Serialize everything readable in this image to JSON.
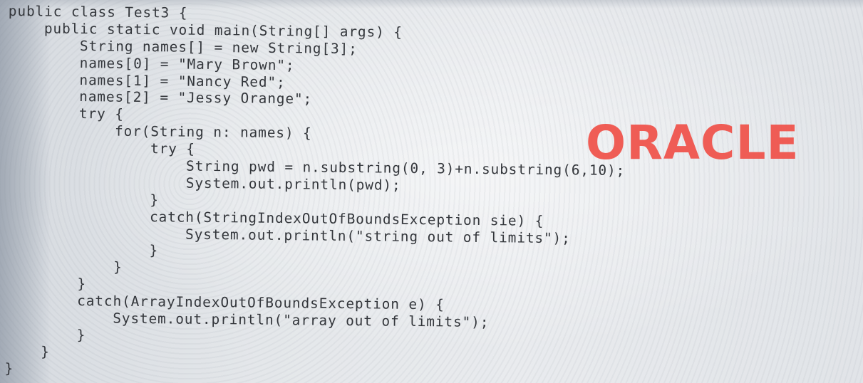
{
  "code": {
    "lines": [
      "public class Test3 {",
      "    public static void main(String[] args) {",
      "        String names[] = new String[3];",
      "        names[0] = \"Mary Brown\";",
      "        names[1] = \"Nancy Red\";",
      "        names[2] = \"Jessy Orange\";",
      "        try {",
      "            for(String n: names) {",
      "                try {",
      "                    String pwd = n.substring(0, 3)+n.substring(6,10);",
      "                    System.out.println(pwd);",
      "                }",
      "                catch(StringIndexOutOfBoundsException sie) {",
      "                    System.out.println(\"string out of limits\");",
      "                }",
      "            }",
      "        }",
      "        catch(ArrayIndexOutOfBoundsException e) {",
      "            System.out.println(\"array out of limits\");",
      "        }",
      "    }",
      "}"
    ]
  },
  "watermark": {
    "text": "ORACLE",
    "color": "#f0524a"
  }
}
